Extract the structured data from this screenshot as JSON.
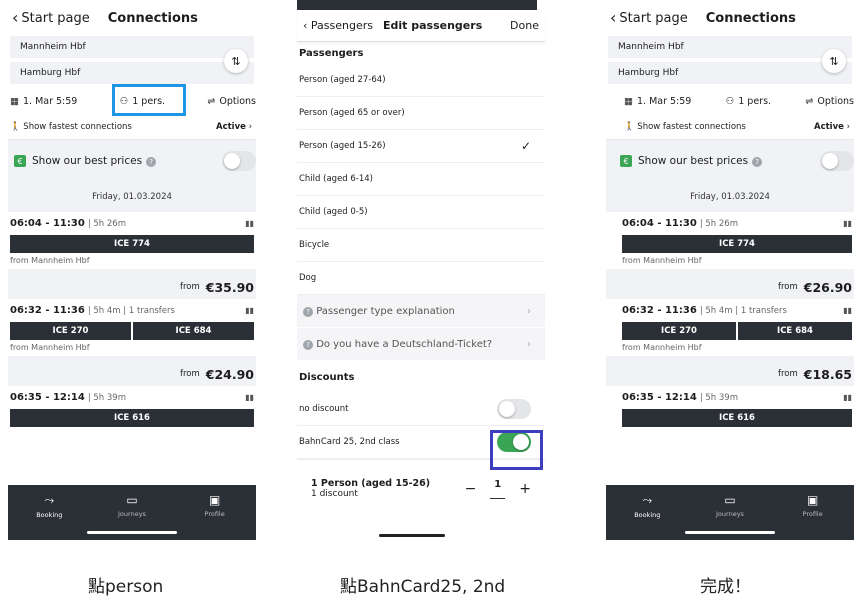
{
  "panels": [
    {
      "back_label": "Start page",
      "title": "Connections",
      "from_station": "Mannheim Hbf",
      "to_station": "Hamburg Hbf",
      "date": "1. Mar 5:59",
      "persons": "1 pers.",
      "options": "Options",
      "fastest": "Show fastest connections",
      "fastest_state": "Active",
      "best_prices": "Show our best prices",
      "day": "Friday, 01.03.2024",
      "connections": [
        {
          "times": "06:04 - 11:30",
          "meta": "| 5h 26m",
          "trains": [
            "ICE 774"
          ],
          "from": "from Mannheim Hbf",
          "price_from": "from",
          "price": "€35.90"
        },
        {
          "times": "06:32 - 11:36",
          "meta": "| 5h 4m | 1 transfers",
          "trains": [
            "ICE 270",
            "ICE 684"
          ],
          "from": "from Mannheim Hbf",
          "price_from": "from",
          "price": "€24.90"
        },
        {
          "times": "06:35 - 12:14",
          "meta": "| 5h 39m",
          "trains": [
            "ICE 616"
          ]
        }
      ],
      "tabs": [
        "Booking",
        "Journeys",
        "Profile"
      ]
    },
    {
      "back_label": "Passengers",
      "title": "Edit passengers",
      "done": "Done",
      "section_passengers": "Passengers",
      "passenger_types": [
        "Person (aged 27-64)",
        "Person (aged 65 or over)",
        "Person (aged 15-26)",
        "Child (aged 6-14)",
        "Child (aged 0-5)",
        "Bicycle",
        "Dog"
      ],
      "selected_mark": "✓",
      "links": [
        "Passenger type explanation",
        "Do you have a Deutschland-Ticket?"
      ],
      "section_discounts": "Discounts",
      "discounts": [
        "no discount",
        "BahnCard 25, 2nd class"
      ],
      "summary_title": "1 Person (aged 15-26)",
      "summary_sub": "1 discount",
      "count": "1"
    },
    {
      "back_label": "Start page",
      "title": "Connections",
      "from_station": "Mannheim Hbf",
      "to_station": "Hamburg Hbf",
      "date": "1. Mar 5:59",
      "persons": "1 pers.",
      "options": "Options",
      "fastest": "Show fastest connections",
      "fastest_state": "Active",
      "best_prices": "Show our best prices",
      "day": "Friday, 01.03.2024",
      "connections": [
        {
          "times": "06:04 - 11:30",
          "meta": "| 5h 26m",
          "trains": [
            "ICE 774"
          ],
          "from": "from Mannheim Hbf",
          "price_from": "from",
          "price": "€26.90"
        },
        {
          "times": "06:32 - 11:36",
          "meta": "| 5h 4m | 1 transfers",
          "trains": [
            "ICE 270",
            "ICE 684"
          ],
          "from": "from Mannheim Hbf",
          "price_from": "from",
          "price": "€18.65"
        },
        {
          "times": "06:35 - 12:14",
          "meta": "| 5h 39m",
          "trains": [
            "ICE 616"
          ]
        }
      ],
      "tabs": [
        "Booking",
        "Journeys",
        "Profile"
      ]
    }
  ],
  "captions": [
    "點person",
    "點BahnCard25, 2nd",
    "完成！"
  ],
  "icons": {
    "back": "chevron-left-icon",
    "swap": "swap-icon",
    "calendar": "calendar-icon",
    "person": "person-icon",
    "options": "sliders-icon",
    "walk": "walking-icon",
    "euro": "euro-icon",
    "info": "info-icon",
    "occupancy": "occupancy-icon",
    "check": "check-icon",
    "minus": "minus-icon",
    "plus": "plus-icon"
  },
  "colors": {
    "highlight_person": "#1e96e6",
    "highlight_bahncard": "#3d3dc0",
    "toggle_on": "#3aa655",
    "train_badge": "#2b2f36"
  }
}
